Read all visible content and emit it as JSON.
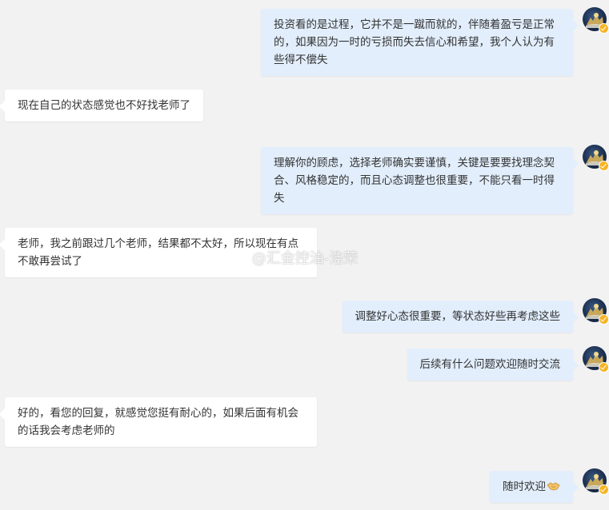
{
  "messages": [
    {
      "side": "right",
      "text": "投资看的是过程，它并不是一蹴而就的，伴随着盈亏是正常的，如果因为一时的亏损而失去信心和希望，我个人认为有些得不偿失"
    },
    {
      "side": "left",
      "text": "现在自己的状态感觉也不好找老师了"
    },
    {
      "side": "right",
      "text": "理解你的顾虑，选择老师确实要谨慎，关键是要要找理念契合、风格稳定的，而且心态调整也很重要，不能只看一时得失"
    },
    {
      "side": "left",
      "text": "老师，我之前跟过几个老师，结果都不太好，所以现在有点不敢再尝试了"
    },
    {
      "side": "right",
      "text": "调整好心态很重要，等状态好些再考虑这些"
    },
    {
      "side": "right",
      "text": "后续有什么问题欢迎随时交流"
    },
    {
      "side": "left",
      "text": "好的，看您的回复，就感觉您挺有耐心的，如果后面有机会的话我会考虑老师的"
    },
    {
      "side": "right",
      "text": "随时欢迎",
      "emoji": "handshake-emoji"
    }
  ],
  "watermark": {
    "text": "@汇金控油-浩荣",
    "icon": "weibo-logo-icon"
  },
  "avatar": {
    "icon": "user-avatar-icon",
    "badge": "verified-badge-icon",
    "badge_color": "#f6b422"
  },
  "colors": {
    "background": "#f2f2f2",
    "bubble_outgoing": "#e2eefc",
    "bubble_incoming": "#ffffff",
    "text": "#333333"
  }
}
